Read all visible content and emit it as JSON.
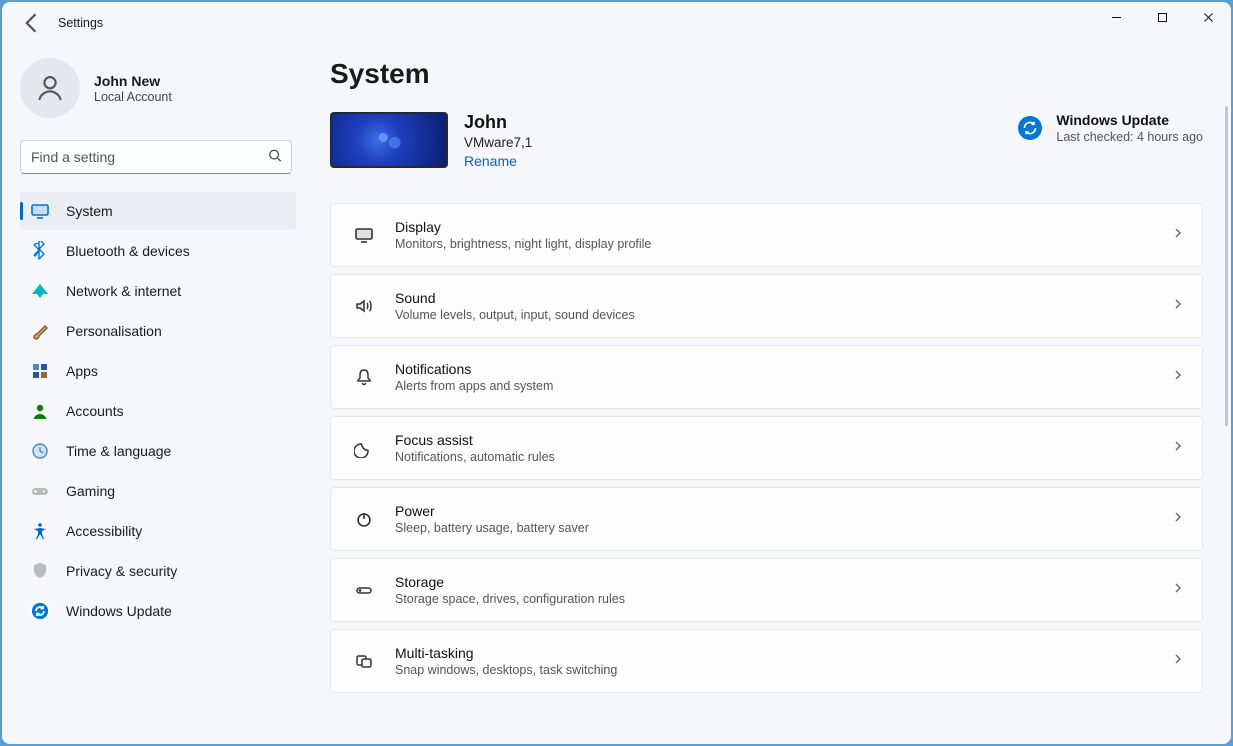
{
  "window": {
    "title": "Settings"
  },
  "account": {
    "name": "John New",
    "type": "Local Account"
  },
  "search": {
    "placeholder": "Find a setting"
  },
  "sidebar": {
    "items": [
      {
        "id": "system",
        "label": "System",
        "icon": "monitor",
        "color": "#0078d4",
        "active": true
      },
      {
        "id": "bluetooth",
        "label": "Bluetooth & devices",
        "icon": "bluetooth",
        "color": "#0078d4"
      },
      {
        "id": "network",
        "label": "Network & internet",
        "icon": "wifi",
        "color": "#00b7c3"
      },
      {
        "id": "personalisation",
        "label": "Personalisation",
        "icon": "brush",
        "color": "#8e562e"
      },
      {
        "id": "apps",
        "label": "Apps",
        "icon": "apps",
        "color": "#5b5fc7"
      },
      {
        "id": "accounts",
        "label": "Accounts",
        "icon": "person",
        "color": "#107c10"
      },
      {
        "id": "time",
        "label": "Time & language",
        "icon": "clock",
        "color": "#4f88c7"
      },
      {
        "id": "gaming",
        "label": "Gaming",
        "icon": "gamepad",
        "color": "#888"
      },
      {
        "id": "accessibility",
        "label": "Accessibility",
        "icon": "access",
        "color": "#0067c0"
      },
      {
        "id": "privacy",
        "label": "Privacy & security",
        "icon": "shield",
        "color": "#8a8a8a"
      },
      {
        "id": "update",
        "label": "Windows Update",
        "icon": "refresh",
        "color": "#0078d4"
      }
    ]
  },
  "page": {
    "title": "System",
    "device": {
      "name": "John",
      "model": "VMware7,1",
      "rename_label": "Rename"
    },
    "windows_update": {
      "title": "Windows Update",
      "status": "Last checked: 4 hours ago"
    },
    "tiles": [
      {
        "id": "display",
        "icon": "monitor",
        "title": "Display",
        "sub": "Monitors, brightness, night light, display profile"
      },
      {
        "id": "sound",
        "icon": "sound",
        "title": "Sound",
        "sub": "Volume levels, output, input, sound devices"
      },
      {
        "id": "notifications",
        "icon": "bell",
        "title": "Notifications",
        "sub": "Alerts from apps and system"
      },
      {
        "id": "focus",
        "icon": "moon",
        "title": "Focus assist",
        "sub": "Notifications, automatic rules"
      },
      {
        "id": "power",
        "icon": "power",
        "title": "Power",
        "sub": "Sleep, battery usage, battery saver"
      },
      {
        "id": "storage",
        "icon": "storage",
        "title": "Storage",
        "sub": "Storage space, drives, configuration rules"
      },
      {
        "id": "multitask",
        "icon": "multitask",
        "title": "Multi-tasking",
        "sub": "Snap windows, desktops, task switching"
      }
    ]
  }
}
